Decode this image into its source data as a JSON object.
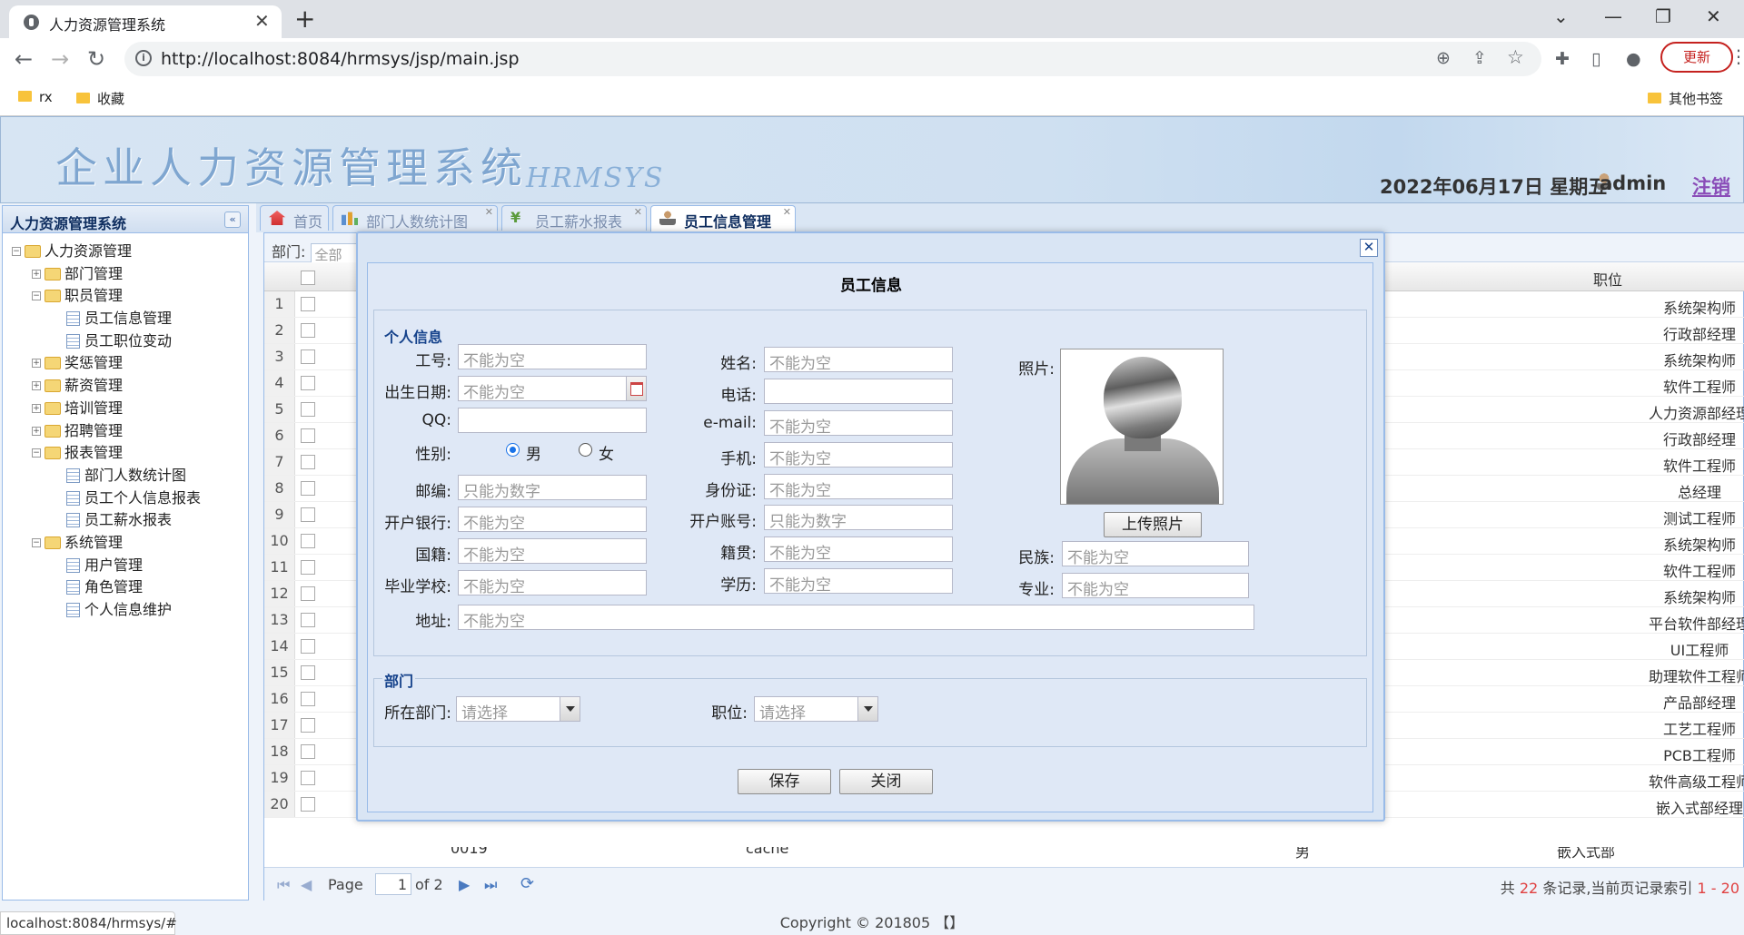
{
  "browser": {
    "tab_title": "人力资源管理系统",
    "url": "http://localhost:8084/hrmsys/jsp/main.jsp",
    "update_label": "更新",
    "bookmarks": [
      "rx",
      "收藏"
    ],
    "other_bookmarks": "其他书签",
    "status_url": "localhost:8084/hrmsys/#"
  },
  "banner": {
    "title": "企业人力资源管理系统",
    "subtitle": "HRMSYS",
    "date": "2022年06月17日 星期五",
    "user": "admin",
    "logout": "注销"
  },
  "west": {
    "header": "人力资源管理系统",
    "tree": [
      {
        "label": "人力资源管理",
        "level": 0,
        "kind": "folder",
        "open": true
      },
      {
        "label": "部门管理",
        "level": 1,
        "kind": "folder",
        "open": false
      },
      {
        "label": "职员管理",
        "level": 1,
        "kind": "folder",
        "open": true
      },
      {
        "label": "员工信息管理",
        "level": 2,
        "kind": "page"
      },
      {
        "label": "员工职位变动",
        "level": 2,
        "kind": "page"
      },
      {
        "label": "奖惩管理",
        "level": 1,
        "kind": "folder",
        "open": false
      },
      {
        "label": "薪资管理",
        "level": 1,
        "kind": "folder",
        "open": false
      },
      {
        "label": "培训管理",
        "level": 1,
        "kind": "folder",
        "open": false
      },
      {
        "label": "招聘管理",
        "level": 1,
        "kind": "folder",
        "open": false
      },
      {
        "label": "报表管理",
        "level": 1,
        "kind": "folder",
        "open": true
      },
      {
        "label": "部门人数统计图",
        "level": 2,
        "kind": "page"
      },
      {
        "label": "员工个人信息报表",
        "level": 2,
        "kind": "page"
      },
      {
        "label": "员工薪水报表",
        "level": 2,
        "kind": "page"
      },
      {
        "label": "系统管理",
        "level": 1,
        "kind": "folder",
        "open": true
      },
      {
        "label": "用户管理",
        "level": 2,
        "kind": "page"
      },
      {
        "label": "角色管理",
        "level": 2,
        "kind": "page"
      },
      {
        "label": "个人信息维护",
        "level": 2,
        "kind": "page"
      }
    ]
  },
  "tabs": [
    {
      "label": "首页",
      "icon": "home-icon"
    },
    {
      "label": "部门人数统计图",
      "icon": "chart-icon"
    },
    {
      "label": "员工薪水报表",
      "icon": "yen-icon"
    },
    {
      "label": "员工信息管理",
      "icon": "user-icon"
    }
  ],
  "grid": {
    "dept_label": "部门:",
    "dept_value": "全部",
    "col_position": "职位",
    "rows": [
      {
        "n": "1",
        "pos": "系统架构师"
      },
      {
        "n": "2",
        "pos": "行政部经理"
      },
      {
        "n": "3",
        "pos": "系统架构师"
      },
      {
        "n": "4",
        "pos": "软件工程师"
      },
      {
        "n": "5",
        "pos": "人力资源部经理"
      },
      {
        "n": "6",
        "pos": "行政部经理"
      },
      {
        "n": "7",
        "pos": "软件工程师"
      },
      {
        "n": "8",
        "pos": "总经理"
      },
      {
        "n": "9",
        "pos": "测试工程师"
      },
      {
        "n": "10",
        "pos": "系统架构师"
      },
      {
        "n": "11",
        "pos": "软件工程师"
      },
      {
        "n": "12",
        "pos": "系统架构师"
      },
      {
        "n": "13",
        "pos": "平台软件部经理"
      },
      {
        "n": "14",
        "pos": "UI工程师"
      },
      {
        "n": "15",
        "pos": "助理软件工程师"
      },
      {
        "n": "16",
        "pos": "产品部经理"
      },
      {
        "n": "17",
        "pos": "工艺工程师"
      },
      {
        "n": "18",
        "pos": "PCB工程师"
      },
      {
        "n": "19",
        "pos": "软件高级工程师"
      },
      {
        "n": "20",
        "pos": "嵌入式部经理"
      }
    ],
    "row20_partial": {
      "id": "0019",
      "name": "cache",
      "sex": "男",
      "dept": "嵌入式部"
    },
    "pager": {
      "page_label": "Page",
      "page_value": "1",
      "of": "of 2",
      "total_prefix": "共",
      "total": "22",
      "total_mid": "条记录,当前页记录索引",
      "range": "1 - 20"
    }
  },
  "footer": "Copyright © 201805 【】",
  "modal": {
    "title": "员工信息",
    "personal_legend": "个人信息",
    "dept_legend": "部门",
    "fields": {
      "emp_no": {
        "label": "工号:",
        "placeholder": "不能为空"
      },
      "birth": {
        "label": "出生日期:",
        "placeholder": "不能为空"
      },
      "qq": {
        "label": "QQ:",
        "placeholder": ""
      },
      "gender": {
        "label": "性别:",
        "male": "男",
        "female": "女",
        "selected": "男"
      },
      "postcode": {
        "label": "邮编:",
        "placeholder": "只能为数字"
      },
      "bank": {
        "label": "开户银行:",
        "placeholder": "不能为空"
      },
      "nationality": {
        "label": "国籍:",
        "placeholder": "不能为空"
      },
      "school": {
        "label": "毕业学校:",
        "placeholder": "不能为空"
      },
      "name": {
        "label": "姓名:",
        "placeholder": "不能为空"
      },
      "phone": {
        "label": "电话:",
        "placeholder": ""
      },
      "email": {
        "label": "e-mail:",
        "placeholder": "不能为空"
      },
      "mobile": {
        "label": "手机:",
        "placeholder": "不能为空"
      },
      "id_card": {
        "label": "身份证:",
        "placeholder": "不能为空"
      },
      "account": {
        "label": "开户账号:",
        "placeholder": "只能为数字"
      },
      "native": {
        "label": "籍贯:",
        "placeholder": "不能为空"
      },
      "education": {
        "label": "学历:",
        "placeholder": "不能为空"
      },
      "photo": {
        "label": "照片:"
      },
      "nation": {
        "label": "民族:",
        "placeholder": "不能为空"
      },
      "major": {
        "label": "专业:",
        "placeholder": "不能为空"
      },
      "address": {
        "label": "地址:",
        "placeholder": "不能为空"
      },
      "department": {
        "label": "所在部门:",
        "value": "请选择"
      },
      "position": {
        "label": "职位:",
        "value": "请选择"
      }
    },
    "upload_label": "上传照片",
    "save_label": "保存",
    "close_label": "关闭"
  }
}
